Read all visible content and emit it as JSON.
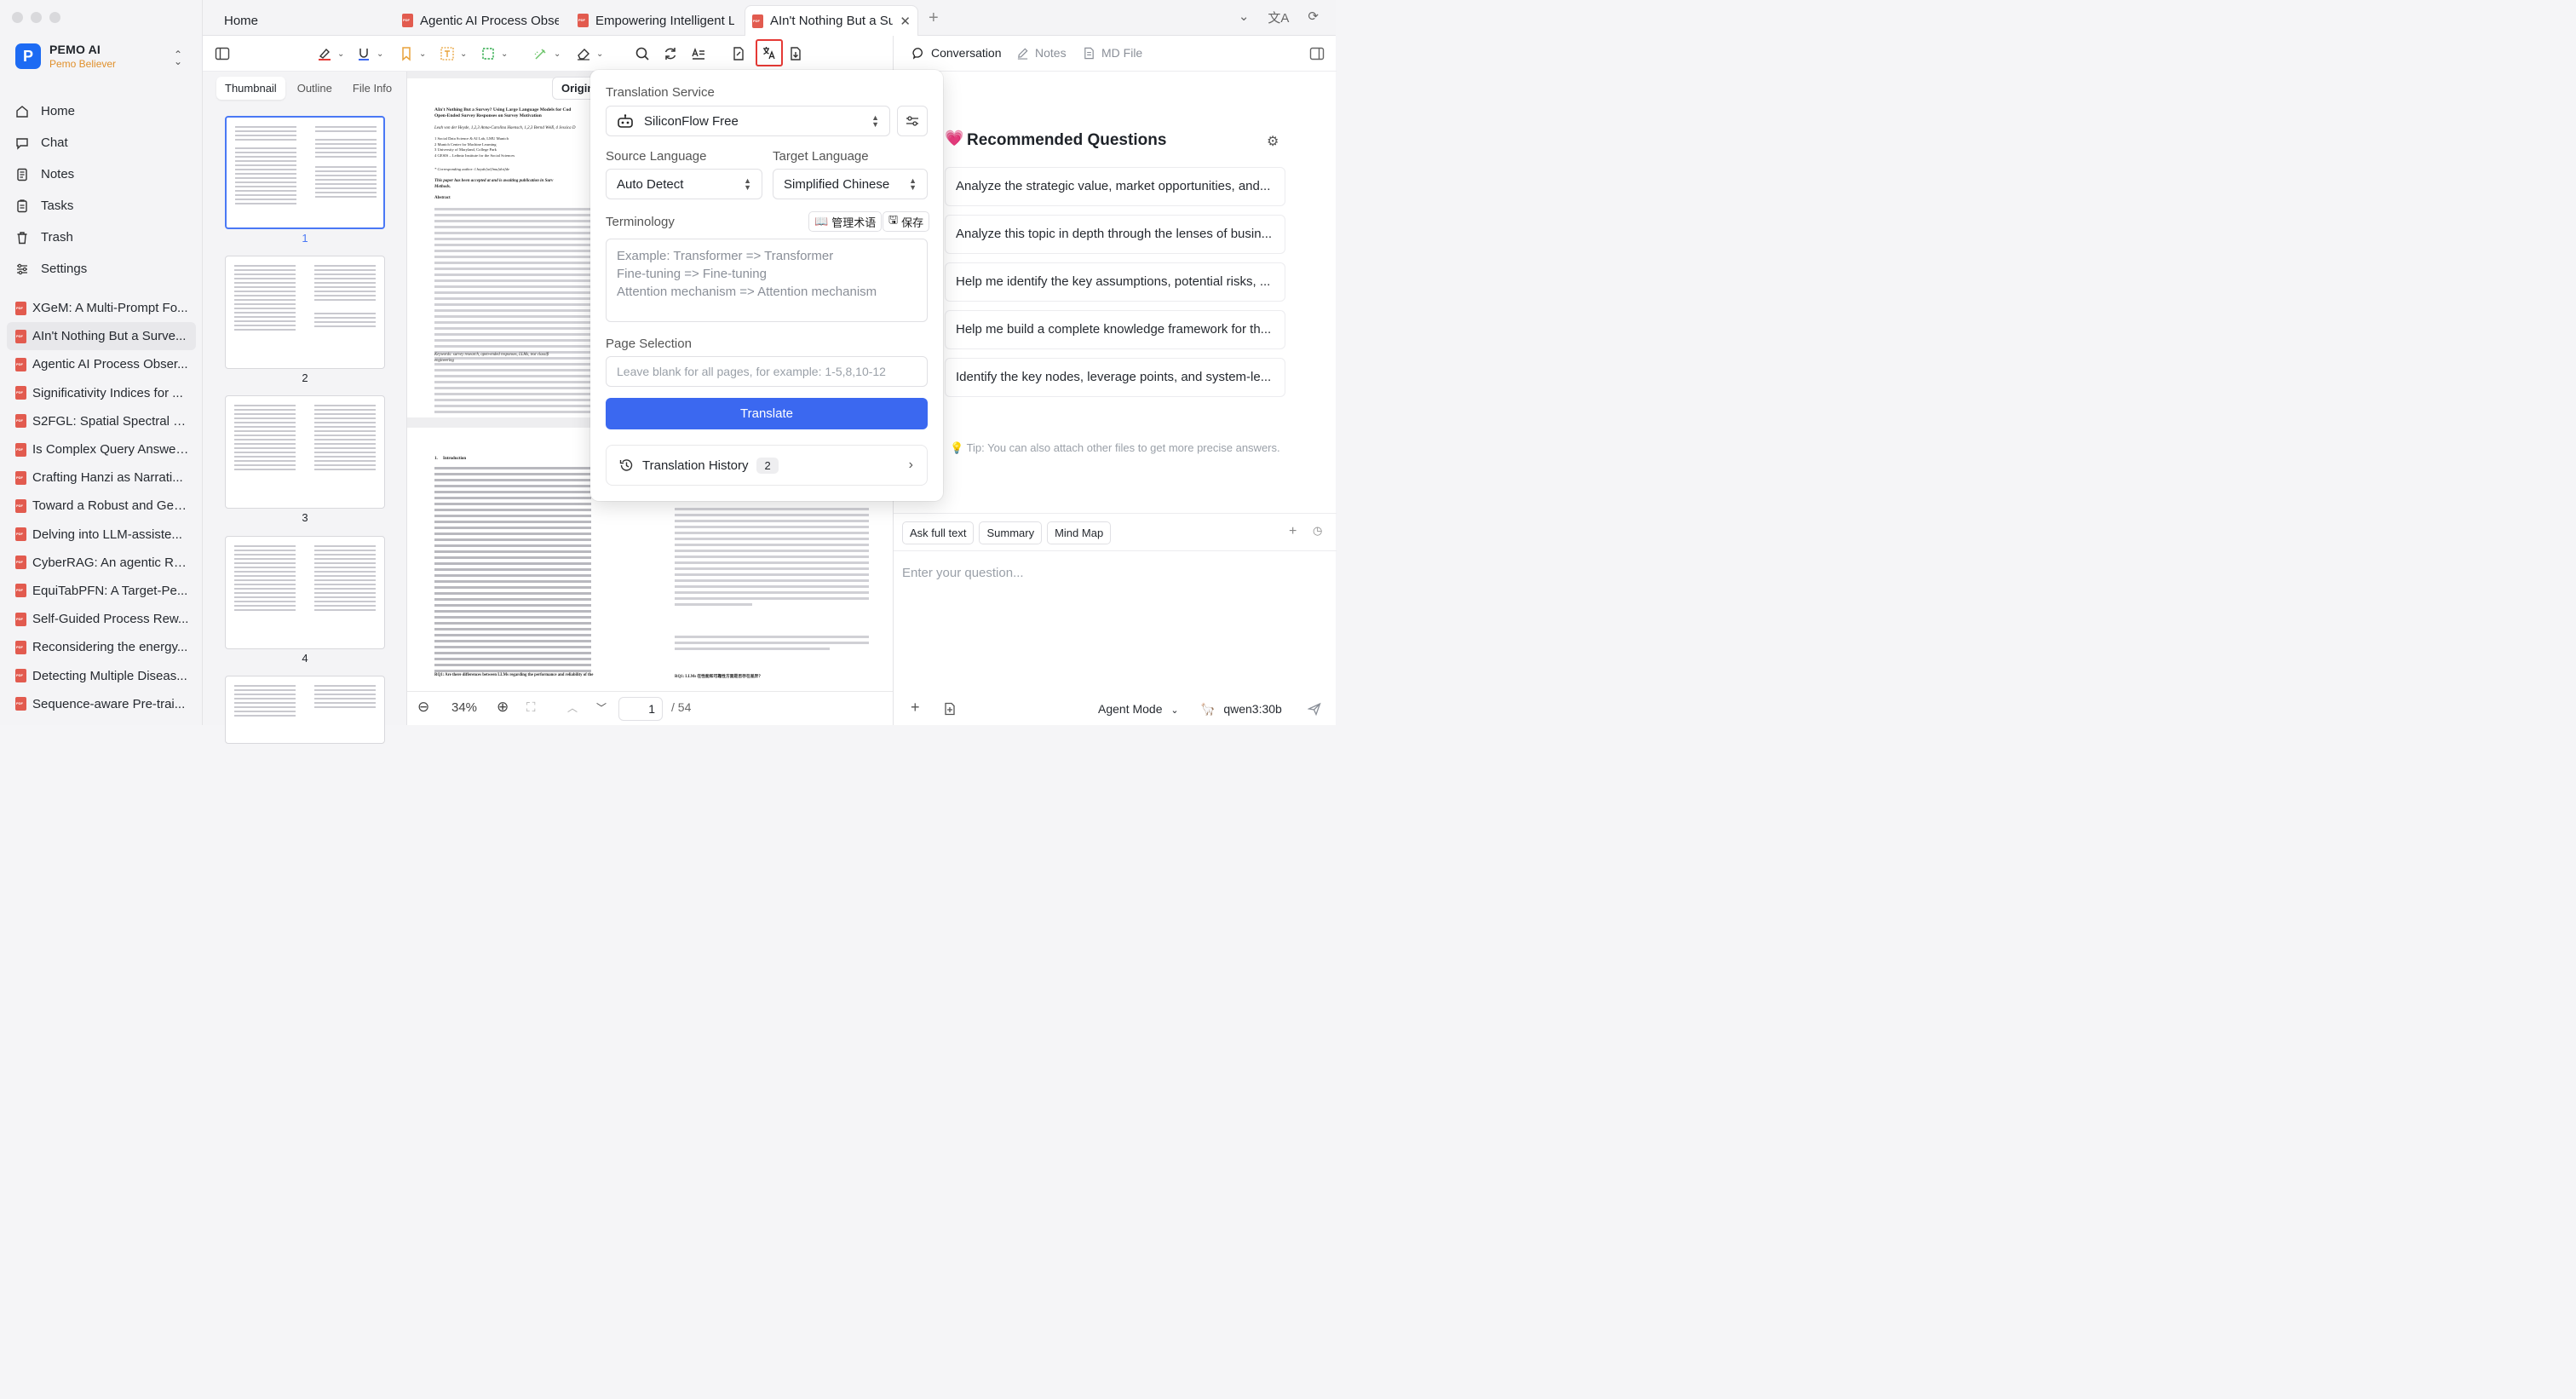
{
  "app": {
    "brand_name": "PEMO AI",
    "brand_sub": "Pemo Believer",
    "brand_initial": "P"
  },
  "nav": [
    {
      "label": "Home",
      "icon": "home-icon"
    },
    {
      "label": "Chat",
      "icon": "chat-icon"
    },
    {
      "label": "Notes",
      "icon": "notes-icon"
    },
    {
      "label": "Tasks",
      "icon": "tasks-icon"
    },
    {
      "label": "Trash",
      "icon": "trash-icon"
    },
    {
      "label": "Settings",
      "icon": "settings-icon"
    }
  ],
  "documents": [
    "XGeM: A Multi-Prompt Fo...",
    "AIn't Nothing But a Surve...",
    "Agentic AI Process Obser...",
    "Significativity Indices for ...",
    "S2FGL: Spatial Spectral F...",
    "Is Complex Query Answer...",
    "Crafting Hanzi as Narrati...",
    "Toward a Robust and Gen...",
    "Delving into LLM-assiste...",
    "CyberRAG: An agentic RA...",
    "EquiTabPFN: A Target-Pe...",
    "Self-Guided Process Rew...",
    "Reconsidering the energy...",
    "Detecting Multiple Diseas...",
    "Sequence-aware Pre-trai..."
  ],
  "tabs": {
    "home": "Home",
    "tab1": "Agentic AI Process Obse",
    "tab2": "Empowering Intelligent L",
    "tab3": "AIn't Nothing But a Su",
    "close": "✕",
    "add": "+"
  },
  "thumbnails": {
    "tabs": [
      "Thumbnail",
      "Outline",
      "File Info"
    ],
    "pages": [
      "1",
      "2",
      "3",
      "4"
    ]
  },
  "document": {
    "origin_button": "Origin",
    "title_line1": "AIn't Nothing But a Survey? Using Large Language Models for Cod",
    "title_line2": "Open-Ended Survey Responses on Survey Motivation",
    "authors": "Leah von der Heyde, 1,2,3 Anna-Carolina Haensch, 1,2,3 Bernd Weiß, 4 Jessica D",
    "aff1": "1 Social Data Science & AI Lab, LMU Munich",
    "aff2": "2 Munich Center for Machine Learning",
    "aff3": "3 University of Maryland, College Park",
    "aff4": "4 GESIS – Leibniz Institute for the Social Sciences",
    "corresponding": "* Corresponding author: l.heyde[at]lmu[dot]de",
    "note": "This paper has been accepted at and is awaiting publication in Surv",
    "note2": "Methods.",
    "abstract": "Abstract",
    "keywords": "Keywords: survey research, open-ended responses, LLMs, text classifi",
    "keywords2": "engineering",
    "intro": "1.     Introduction",
    "rq1": "RQ1: Are there differences between LLMs regarding the performance and reliability of the",
    "rq1_zh": "RQ1: LLMs 在性能和可靠性方面是否存在差异？"
  },
  "doc_controls": {
    "zoom": "34%",
    "page_current": "1",
    "page_total": "/ 54"
  },
  "translation": {
    "service_label": "Translation Service",
    "service_value": "SiliconFlow Free",
    "source_label": "Source Language",
    "source_value": "Auto Detect",
    "target_label": "Target Language",
    "target_value": "Simplified Chinese",
    "terminology_label": "Terminology",
    "manage_terms": "管理术语",
    "save": "保存",
    "terminology_placeholder_1": "Example: Transformer => Transformer",
    "terminology_placeholder_2": "Fine-tuning => Fine-tuning",
    "terminology_placeholder_3": "Attention mechanism => Attention mechanism",
    "page_label": "Page Selection",
    "page_placeholder": "Leave blank for all pages, for example: 1-5,8,10-12",
    "translate_button": "Translate",
    "history_label": "Translation History",
    "history_count": "2"
  },
  "right_panel": {
    "tabs": [
      "Conversation",
      "Notes",
      "MD File"
    ],
    "rq_title": "Recommended Questions",
    "questions": [
      "Analyze the strategic value, market opportunities, and...",
      "Analyze this topic in depth through the lenses of busin...",
      "Help me identify the key assumptions, potential risks, ...",
      "Help me build a complete knowledge framework for th...",
      "Identify the key nodes, leverage points, and system-le..."
    ],
    "tip": "💡 Tip: You can also attach other files to get more precise answers.",
    "chips": [
      "Ask full text",
      "Summary",
      "Mind Map"
    ],
    "question_placeholder": "Enter your question...",
    "agent_mode": "Agent Mode",
    "model": "qwen3:30b"
  },
  "colors": {
    "accent": "#3b68f0",
    "brand_orange": "#e0902c",
    "highlight_red": "#e53935",
    "pdf_red": "#e25b4f"
  }
}
